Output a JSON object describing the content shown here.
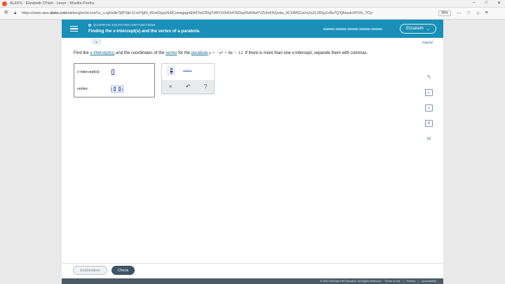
{
  "window": {
    "title": "ALEKS - Elizabeth O'Neil - Learn - Mozilla Firefox",
    "controls": [
      "–",
      "□",
      "✕"
    ]
  },
  "browser": {
    "url_prefix": "https://www-awn.",
    "url_domain": "aleks.com",
    "url_rest": "/alekscgi/x/Isl.exe/1o_u-IgNslkr7j8P3jH-lJ-wYfgfV_8Ux63ypUfu0Conwgqg4&WI7w2ZRgTWFI1XKKh47EDqeRzRAoPV2UmFNQudu_4CXfMS1aVxZoZL28Xg1c8w7QYjBaxdsSPXfx_YCp",
    "zoom": "90%",
    "tool_icons": [
      "⋯",
      "♡",
      "☆",
      "≡"
    ]
  },
  "header": {
    "topic": "QUADRATIC EQUATIONS AND FUNCTIONS",
    "lesson_title": "Finding the x-intercept(s) and the vertex of a parabola",
    "user_name": "Elizabeth",
    "accent": "#1a8fb7"
  },
  "language_link": "Español",
  "question": {
    "part1": "Find the ",
    "link1": "x-intercept(s)",
    "part2": " and the coordinates of the ",
    "link2": "vertex",
    "part3": " for the ",
    "link3": "parabola",
    "equation": "y = −x² + 8x − 12",
    "part4": ". If there is more than one x-intercept, separate them with commas."
  },
  "answer": {
    "x_intercepts_label": "x-intercept(s):",
    "x_intercepts_value": "",
    "vertex_label": "vertex:",
    "vertex_value": ""
  },
  "palette": {
    "ellipsis": "…,…",
    "clear": "×",
    "undo": "↶",
    "help": "?"
  },
  "side_tools": [
    "pencil-off-icon",
    "video-icon",
    "calculator-icon",
    "ebook-icon",
    "mail-icon"
  ],
  "actions": {
    "explanation": "Explanation",
    "check": "Check"
  },
  "footer": {
    "copyright": "© 2020 McGraw-Hill Education. All Rights Reserved.",
    "terms": "Terms of Use",
    "privacy": "Privacy",
    "accessibility": "Accessibility"
  }
}
